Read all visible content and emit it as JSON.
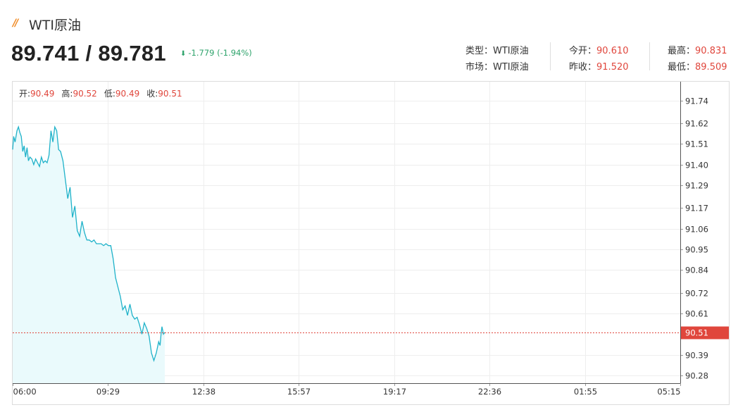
{
  "header": {
    "title": "WTI原油",
    "price": "89.741 / 89.781",
    "change": "-1.779 (-1.94%)"
  },
  "info": {
    "type_label": "类型：",
    "type_value": "WTI原油",
    "market_label": "市场：",
    "market_value": "WTI原油",
    "open_label": "今开：",
    "open_value": "90.610",
    "prev_close_label": "昨收：",
    "prev_close_value": "91.520",
    "high_label": "最高：",
    "high_value": "90.831",
    "low_label": "最低：",
    "low_value": "89.509"
  },
  "ohlc": {
    "open_label": "开:",
    "open_value": "90.49",
    "high_label": "高:",
    "high_value": "90.52",
    "low_label": "低:",
    "low_value": "90.49",
    "close_label": "收:",
    "close_value": "90.51"
  },
  "colors": {
    "line": "#1fb2c9",
    "fill": "#eafafc",
    "marker": "#e0463c",
    "up": "#e0463c",
    "down": "#2ea36b"
  },
  "chart_data": {
    "type": "area",
    "x_ticks": [
      "06:00",
      "09:29",
      "12:38",
      "15:57",
      "19:17",
      "22:36",
      "01:55",
      "05:15"
    ],
    "y_ticks": [
      91.74,
      91.62,
      91.51,
      91.4,
      91.29,
      91.17,
      91.06,
      90.95,
      90.84,
      90.72,
      90.61,
      90.39,
      90.28
    ],
    "ylim": [
      90.24,
      91.84
    ],
    "x_range_minutes": [
      0,
      1395
    ],
    "current_value": 90.51,
    "current_label": "90.51",
    "series": [
      {
        "x": [
          0,
          2,
          5,
          9,
          12,
          15,
          18,
          21,
          24,
          27,
          30,
          33,
          36,
          40,
          44,
          48,
          52,
          56,
          60,
          64,
          68,
          72,
          76,
          80,
          84,
          88,
          92,
          96,
          100,
          105,
          110,
          115,
          120,
          125,
          130,
          135,
          140,
          145,
          150,
          155,
          160,
          165,
          170,
          175,
          180,
          185,
          190,
          195,
          200,
          205,
          210,
          215,
          220,
          225,
          230,
          235,
          240,
          245,
          250,
          255,
          260,
          265,
          270,
          275,
          280,
          285,
          290,
          295,
          300,
          305,
          308,
          310,
          312,
          315,
          318
        ],
        "y": [
          91.48,
          91.55,
          91.52,
          91.58,
          91.6,
          91.57,
          91.55,
          91.47,
          91.5,
          91.44,
          91.49,
          91.42,
          91.44,
          91.43,
          91.4,
          91.43,
          91.41,
          91.39,
          91.44,
          91.41,
          91.42,
          91.41,
          91.45,
          91.58,
          91.52,
          91.6,
          91.58,
          91.48,
          91.47,
          91.42,
          91.32,
          91.22,
          91.28,
          91.12,
          91.18,
          91.05,
          91.02,
          91.1,
          91.04,
          91.0,
          91.0,
          90.99,
          91.0,
          90.98,
          90.98,
          90.98,
          90.97,
          90.98,
          90.97,
          90.97,
          90.9,
          90.8,
          90.75,
          90.7,
          90.63,
          90.65,
          90.6,
          90.66,
          90.6,
          90.58,
          90.59,
          90.55,
          90.5,
          90.56,
          90.53,
          90.49,
          90.4,
          90.36,
          90.4,
          90.46,
          90.44,
          90.5,
          90.54,
          90.5,
          90.51
        ]
      }
    ]
  }
}
